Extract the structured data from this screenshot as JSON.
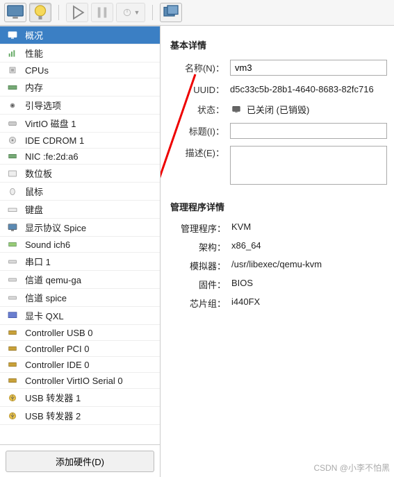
{
  "sidebar": {
    "items": [
      {
        "label": "概况",
        "icon": "monitor"
      },
      {
        "label": "性能",
        "icon": "chart"
      },
      {
        "label": "CPUs",
        "icon": "cpu"
      },
      {
        "label": "内存",
        "icon": "memory"
      },
      {
        "label": "引导选项",
        "icon": "gear"
      },
      {
        "label": "VirtIO 磁盘 1",
        "icon": "disk"
      },
      {
        "label": "IDE CDROM 1",
        "icon": "cdrom"
      },
      {
        "label": "NIC :fe:2d:a6",
        "icon": "nic"
      },
      {
        "label": "数位板",
        "icon": "tablet"
      },
      {
        "label": "鼠标",
        "icon": "mouse"
      },
      {
        "label": "键盘",
        "icon": "keyboard"
      },
      {
        "label": "显示协议 Spice",
        "icon": "monitor"
      },
      {
        "label": "Sound ich6",
        "icon": "sound"
      },
      {
        "label": "串口 1",
        "icon": "port"
      },
      {
        "label": "信道 qemu-ga",
        "icon": "port"
      },
      {
        "label": "信道 spice",
        "icon": "port"
      },
      {
        "label": "显卡 QXL",
        "icon": "video"
      },
      {
        "label": "Controller USB 0",
        "icon": "controller"
      },
      {
        "label": "Controller PCI 0",
        "icon": "controller"
      },
      {
        "label": "Controller IDE 0",
        "icon": "controller"
      },
      {
        "label": "Controller VirtIO Serial 0",
        "icon": "controller"
      },
      {
        "label": "USB 转发器 1",
        "icon": "usb"
      },
      {
        "label": "USB 转发器 2",
        "icon": "usb"
      }
    ],
    "add_button": "添加硬件(D)"
  },
  "basic": {
    "section_title": "基本详情",
    "name_label": "名称(N)：",
    "name_value": "vm3",
    "uuid_label": "UUID：",
    "uuid_value": "d5c33c5b-28b1-4640-8683-82fc716",
    "status_label": "状态：",
    "status_value": "已关闭 (已销毁)",
    "title_label": "标题(I)：",
    "title_value": "",
    "desc_label": "描述(E)：",
    "desc_value": ""
  },
  "hypervisor": {
    "section_title": "管理程序详情",
    "hypervisor_label": "管理程序：",
    "hypervisor_value": "KVM",
    "arch_label": "架构：",
    "arch_value": "x86_64",
    "emulator_label": "模拟器：",
    "emulator_value": "/usr/libexec/qemu-kvm",
    "firmware_label": "固件：",
    "firmware_value": "BIOS",
    "chipset_label": "芯片组：",
    "chipset_value": "i440FX"
  },
  "watermark": "CSDN @小李不怕黑"
}
